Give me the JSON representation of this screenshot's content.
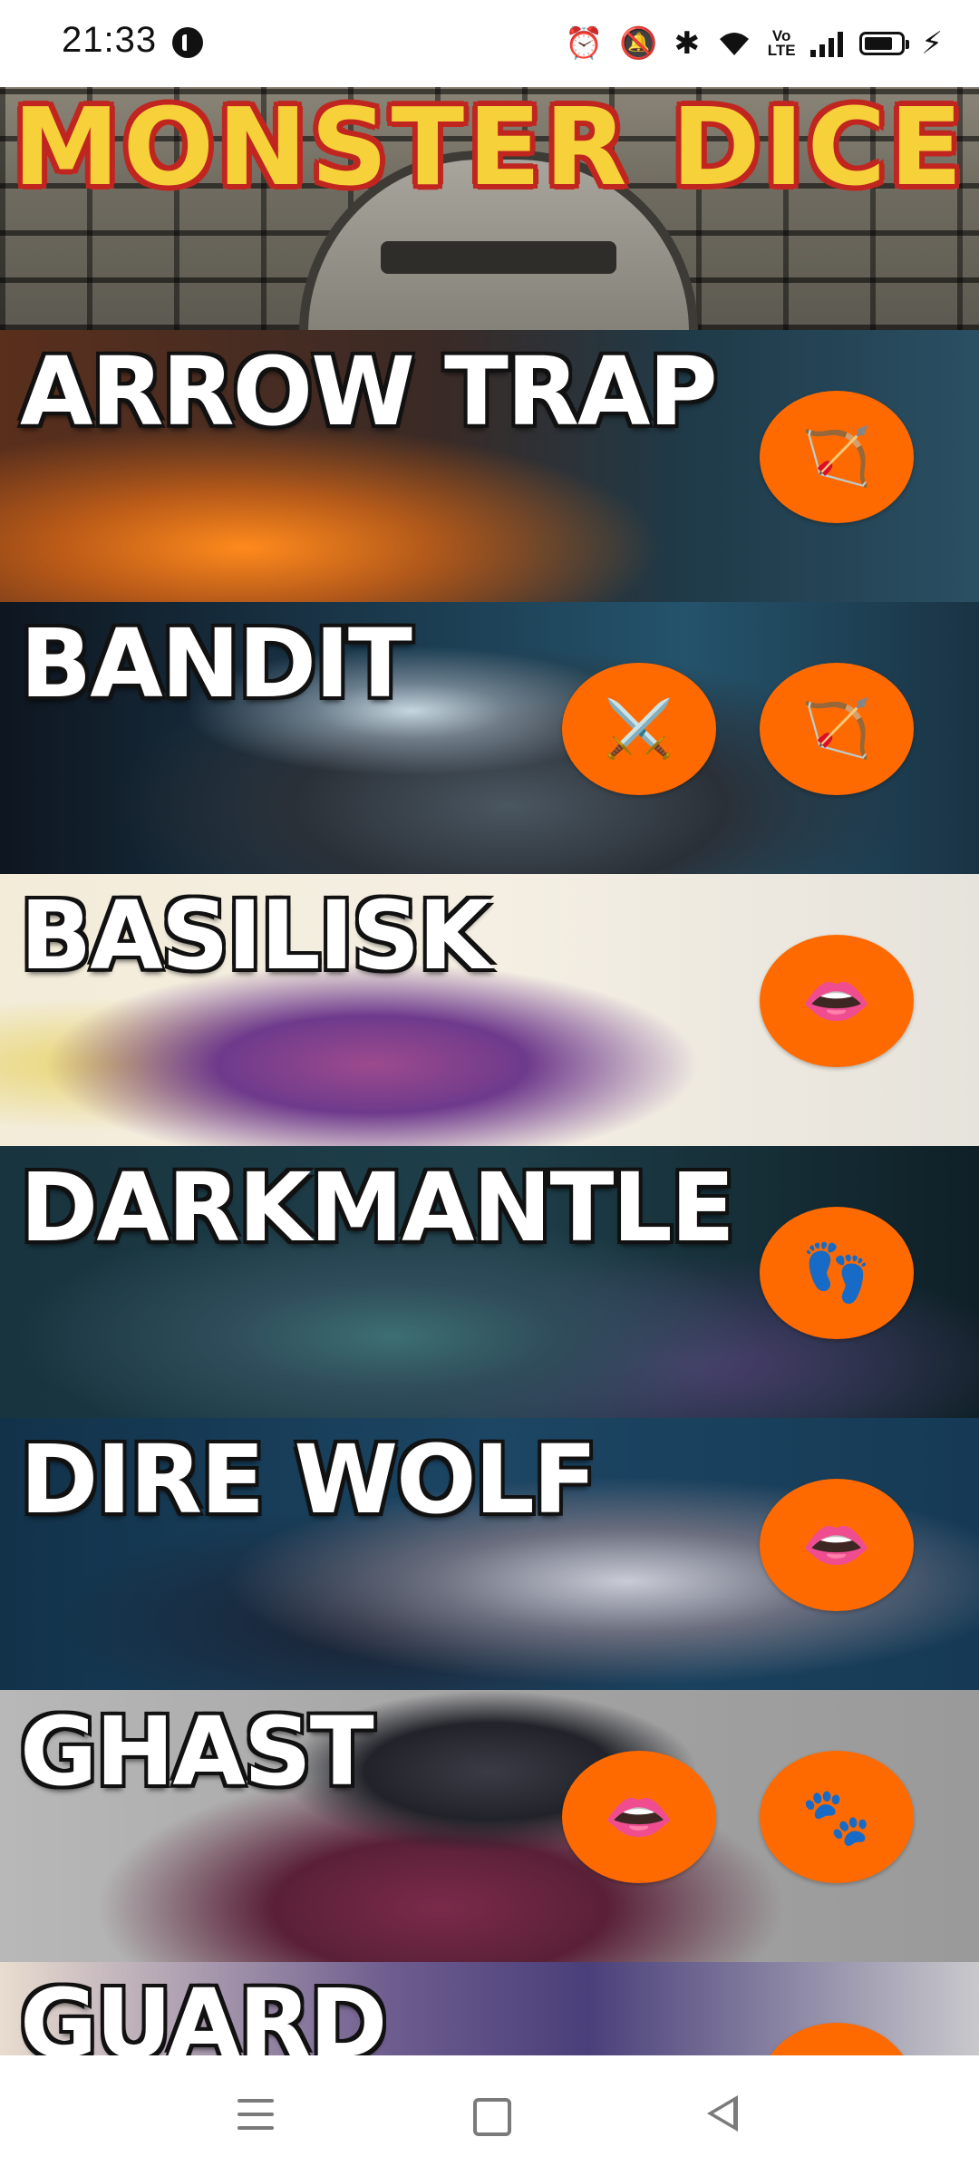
{
  "status_bar": {
    "time": "21:33",
    "icons": [
      "alarm-icon",
      "mute-icon",
      "bluetooth-icon",
      "wifi-icon",
      "volte-icon",
      "signal-icon",
      "battery-icon",
      "charging-icon"
    ],
    "volte_label": "Vo LTE"
  },
  "header": {
    "title": "MONSTER DICE"
  },
  "monsters": [
    {
      "name": "ARROW TRAP",
      "dice": [
        {
          "icon": "bow-and-arrow-icon",
          "glyph": "🏹"
        }
      ]
    },
    {
      "name": "BANDIT",
      "dice": [
        {
          "icon": "crossed-swords-icon",
          "glyph": "⚔️"
        },
        {
          "icon": "bow-and-arrow-icon",
          "glyph": "🏹"
        }
      ]
    },
    {
      "name": "BASILISK",
      "dice": [
        {
          "icon": "mouth-icon",
          "glyph": "👄"
        }
      ]
    },
    {
      "name": "DARKMANTLE",
      "dice": [
        {
          "icon": "footprints-icon",
          "glyph": "👣"
        }
      ]
    },
    {
      "name": "DIRE WOLF",
      "dice": [
        {
          "icon": "mouth-icon",
          "glyph": "👄"
        }
      ]
    },
    {
      "name": "GHAST",
      "dice": [
        {
          "icon": "mouth-icon",
          "glyph": "👄"
        },
        {
          "icon": "paw-prints-icon",
          "glyph": "🐾"
        }
      ]
    },
    {
      "name": "GUARD",
      "dice": []
    }
  ],
  "colors": {
    "die_background": "#ff6a00",
    "title_fill": "#f6d13a",
    "title_outline": "#c0261f"
  }
}
